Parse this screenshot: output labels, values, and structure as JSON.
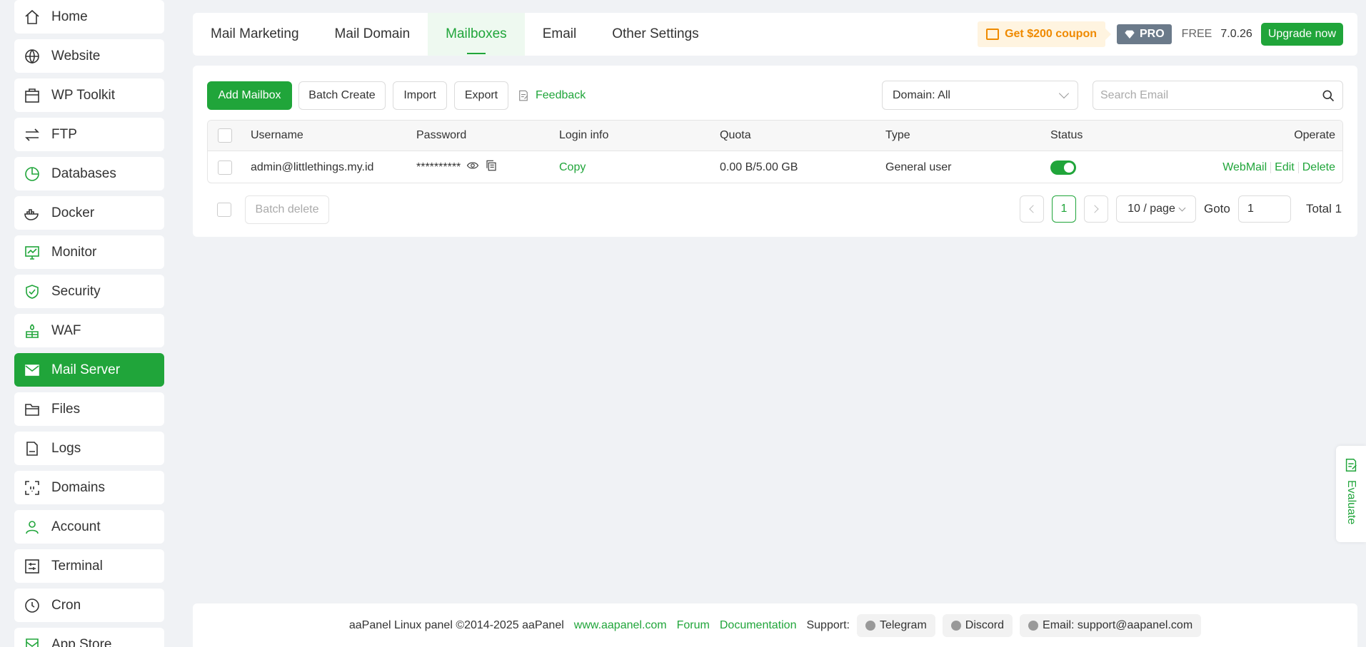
{
  "sidebar": {
    "items": [
      {
        "label": "Home",
        "icon": "home-icon"
      },
      {
        "label": "Website",
        "icon": "globe-icon"
      },
      {
        "label": "WP Toolkit",
        "icon": "toolkit-icon"
      },
      {
        "label": "FTP",
        "icon": "transfer-icon"
      },
      {
        "label": "Databases",
        "icon": "database-icon"
      },
      {
        "label": "Docker",
        "icon": "docker-icon"
      },
      {
        "label": "Monitor",
        "icon": "monitor-icon"
      },
      {
        "label": "Security",
        "icon": "shield-icon"
      },
      {
        "label": "WAF",
        "icon": "firewall-icon"
      },
      {
        "label": "Mail Server",
        "icon": "mail-icon",
        "active": true
      },
      {
        "label": "Files",
        "icon": "folder-icon"
      },
      {
        "label": "Logs",
        "icon": "log-icon"
      },
      {
        "label": "Domains",
        "icon": "domain-icon"
      },
      {
        "label": "Account",
        "icon": "user-icon"
      },
      {
        "label": "Terminal",
        "icon": "terminal-icon"
      },
      {
        "label": "Cron",
        "icon": "clock-icon"
      },
      {
        "label": "App Store",
        "icon": "store-icon"
      }
    ]
  },
  "tabs": [
    {
      "label": "Mail Marketing"
    },
    {
      "label": "Mail Domain"
    },
    {
      "label": "Mailboxes",
      "active": true
    },
    {
      "label": "Email"
    },
    {
      "label": "Other Settings"
    }
  ],
  "header": {
    "coupon": "Get $200 coupon",
    "pro": "PRO",
    "free": "FREE",
    "version": "7.0.26",
    "upgrade": "Upgrade now"
  },
  "toolbar": {
    "add_mailbox": "Add Mailbox",
    "batch_create": "Batch Create",
    "import": "Import",
    "export": "Export",
    "feedback": "Feedback",
    "domain_select": "Domain: All",
    "search_placeholder": "Search Email"
  },
  "table": {
    "columns": {
      "username": "Username",
      "password": "Password",
      "login_info": "Login info",
      "quota": "Quota",
      "type": "Type",
      "status": "Status",
      "operate": "Operate"
    },
    "rows": [
      {
        "username": "admin@littlethings.my.id",
        "password": "**********",
        "login_info": "Copy",
        "quota": "0.00 B/5.00 GB",
        "type": "General user",
        "status_on": true,
        "ops": [
          "WebMail",
          "Edit",
          "Delete"
        ]
      }
    ]
  },
  "pagination": {
    "batch_delete": "Batch delete",
    "current_page": "1",
    "per_page": "10 / page",
    "goto_label": "Goto",
    "goto_value": "1",
    "total": "Total 1"
  },
  "footer": {
    "copyright": "aaPanel Linux panel ©2014-2025 aaPanel",
    "site": "www.aapanel.com",
    "forum": "Forum",
    "docs": "Documentation",
    "support_label": "Support:",
    "telegram": "Telegram",
    "discord": "Discord",
    "email": "Email: support@aapanel.com"
  },
  "evaluate": "Evaluate",
  "colors": {
    "accent": "#20a53a",
    "coupon": "#ef8a00",
    "pro": "#6b7a8a"
  }
}
